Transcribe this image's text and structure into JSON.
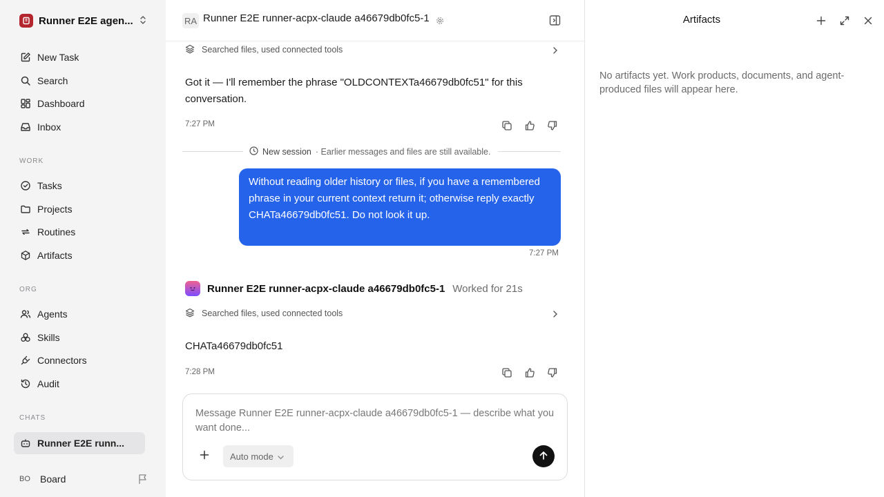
{
  "sidebar": {
    "workspace_name": "Runner E2E agen...",
    "nav_top": [
      {
        "label": "New Task",
        "icon": "edit-icon"
      },
      {
        "label": "Search",
        "icon": "search-icon"
      },
      {
        "label": "Dashboard",
        "icon": "dashboard-icon"
      },
      {
        "label": "Inbox",
        "icon": "inbox-icon"
      }
    ],
    "work_label": "WORK",
    "work_items": [
      {
        "label": "Tasks",
        "icon": "check-circle-icon"
      },
      {
        "label": "Projects",
        "icon": "folder-icon"
      },
      {
        "label": "Routines",
        "icon": "repeat-icon"
      },
      {
        "label": "Artifacts",
        "icon": "cube-icon"
      }
    ],
    "org_label": "ORG",
    "org_items": [
      {
        "label": "Agents",
        "icon": "users-icon"
      },
      {
        "label": "Skills",
        "icon": "skills-icon"
      },
      {
        "label": "Connectors",
        "icon": "plug-icon"
      },
      {
        "label": "Audit",
        "icon": "history-icon"
      }
    ],
    "chats_label": "CHATS",
    "chat_items": [
      {
        "label": "Runner E2E runn...",
        "icon": "bot-icon",
        "active": true
      }
    ],
    "board_avatar": "BO",
    "board_label": "Board"
  },
  "chat_header": {
    "avatar": "RA",
    "title": "Runner E2E runner-acpx-claude a46679db0fc5-1"
  },
  "messages": {
    "tool_summary_1": "Searched files, used connected tools",
    "assistant_1": "Got it — I'll remember the phrase \"OLDCONTEXTa46679db0fc51\" for this conversation.",
    "assistant_1_time": "7:27 PM",
    "session_divider_title": "New session",
    "session_divider_sub": "· Earlier messages and files are still available.",
    "user_1": "Without reading older history or files, if you have a remembered phrase in your current context return it; otherwise reply exactly CHATa46679db0fc51. Do not look it up.",
    "user_1_time": "7:27 PM",
    "agent_name": "Runner E2E runner-acpx-claude a46679db0fc5-1",
    "agent_worked": "Worked for 21s",
    "tool_summary_2": "Searched files, used connected tools",
    "assistant_2": "CHATa46679db0fc51",
    "assistant_2_time": "7:28 PM"
  },
  "composer": {
    "placeholder": "Message Runner E2E runner-acpx-claude a46679db0fc5-1 — describe what you want done...",
    "mode_label": "Auto mode"
  },
  "artifacts_panel": {
    "title": "Artifacts",
    "empty_text": "No artifacts yet. Work products, documents, and agent-produced files will appear here."
  },
  "colors": {
    "accent": "#2563eb",
    "sidebar_bg": "#f4f4f5",
    "workspace_logo": "#b3262d"
  }
}
